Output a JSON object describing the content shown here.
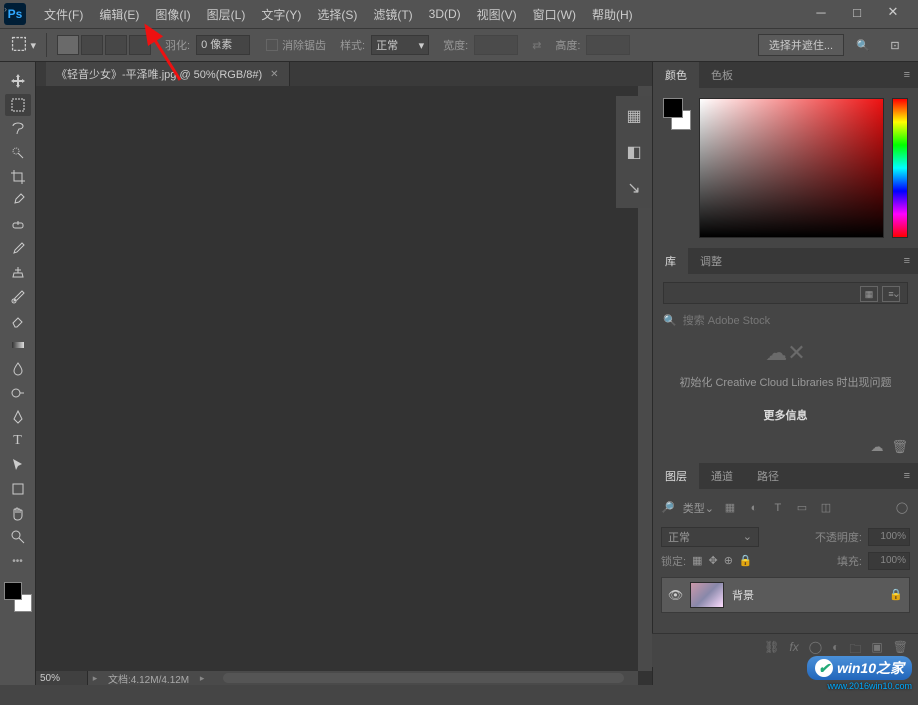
{
  "menu": {
    "items": [
      "文件(F)",
      "编辑(E)",
      "图像(I)",
      "图层(L)",
      "文字(Y)",
      "选择(S)",
      "滤镜(T)",
      "3D(D)",
      "视图(V)",
      "窗口(W)",
      "帮助(H)"
    ]
  },
  "options": {
    "feather_label": "羽化:",
    "feather_value": "0 像素",
    "antialias": "消除锯齿",
    "style_label": "样式:",
    "style_value": "正常",
    "width_label": "宽度:",
    "height_label": "高度:",
    "mask_btn": "选择并遮住..."
  },
  "doc": {
    "tab_title": "《轻音少女》-平泽唯.jpg @ 50%(RGB/8#)",
    "zoom": "50%",
    "docinfo": "文档:4.12M/4.12M"
  },
  "panels": {
    "color_tab": "颜色",
    "swatches_tab": "色板",
    "lib_tab": "库",
    "adjust_tab": "调整",
    "lib_search_placeholder": "搜索 Adobe Stock",
    "lib_msg": "初始化 Creative Cloud Libraries 时出现问题",
    "lib_link": "更多信息",
    "layers_tab": "图层",
    "channels_tab": "通道",
    "paths_tab": "路径",
    "kind_label": "类型",
    "blend_mode": "正常",
    "opacity_label": "不透明度:",
    "opacity_value": "100%",
    "lock_label": "锁定:",
    "fill_label": "填充:",
    "fill_value": "100%",
    "layer_name": "背景"
  },
  "watermark": {
    "t1": "win10之家",
    "t2": "www.2016win10.com"
  }
}
